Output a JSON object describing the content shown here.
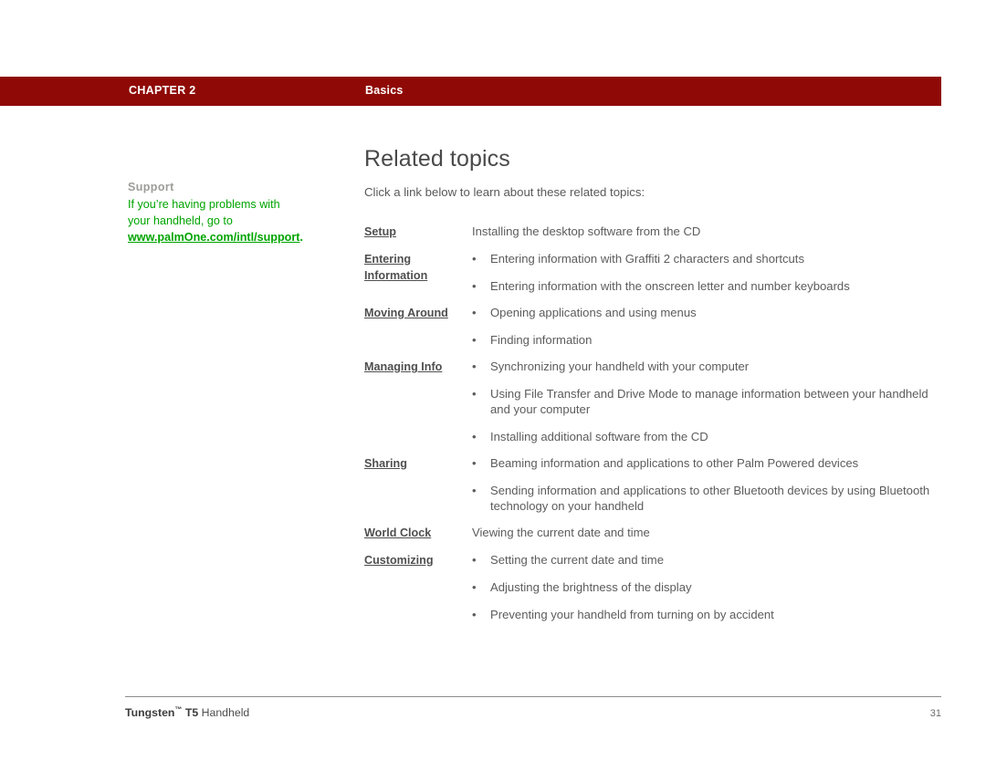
{
  "header": {
    "chapter_label": "CHAPTER 2",
    "section_label": "Basics",
    "bar_color": "#8f0a06"
  },
  "sidebar": {
    "heading": "Support",
    "text_before": "If you’re having problems with your handheld, go to ",
    "link_text": "www.palmOne.com/intl/support",
    "text_after": ".",
    "link_color": "#00a400",
    "heading_color": "#9d9d98"
  },
  "main": {
    "title": "Related topics",
    "intro": "Click a link below to learn about these related topics:"
  },
  "topics": [
    {
      "link": "Setup",
      "items": [
        {
          "bulleted": false,
          "text": "Installing the desktop software from the CD"
        }
      ]
    },
    {
      "link": "Entering Information",
      "items": [
        {
          "bulleted": true,
          "text": "Entering information with Graffiti 2 characters and shortcuts"
        },
        {
          "bulleted": true,
          "text": "Entering information with the onscreen letter and number keyboards"
        }
      ]
    },
    {
      "link": "Moving Around",
      "items": [
        {
          "bulleted": true,
          "text": "Opening applications and using menus"
        },
        {
          "bulleted": true,
          "text": "Finding information"
        }
      ]
    },
    {
      "link": "Managing Info",
      "items": [
        {
          "bulleted": true,
          "text": "Synchronizing your handheld with your computer"
        },
        {
          "bulleted": true,
          "text": "Using File Transfer and Drive Mode to manage information between your handheld and your computer"
        },
        {
          "bulleted": true,
          "text": "Installing additional software from the CD"
        }
      ]
    },
    {
      "link": "Sharing",
      "items": [
        {
          "bulleted": true,
          "text": "Beaming information and applications to other Palm Powered devices"
        },
        {
          "bulleted": true,
          "text": "Sending information and applications to other Bluetooth devices by using Bluetooth technology on your handheld"
        }
      ]
    },
    {
      "link": "World Clock",
      "items": [
        {
          "bulleted": false,
          "text": "Viewing the current date and time"
        }
      ]
    },
    {
      "link": "Customizing",
      "items": [
        {
          "bulleted": true,
          "text": "Setting the current date and time"
        },
        {
          "bulleted": true,
          "text": "Adjusting the brightness of the display"
        },
        {
          "bulleted": true,
          "text": "Preventing your handheld from turning on by accident"
        }
      ]
    }
  ],
  "footer": {
    "product_brand": "Tungsten",
    "product_tm": "™",
    "product_model": " T5",
    "product_suffix": " Handheld",
    "page_number": "31"
  },
  "icons": {
    "bullet": "•"
  }
}
